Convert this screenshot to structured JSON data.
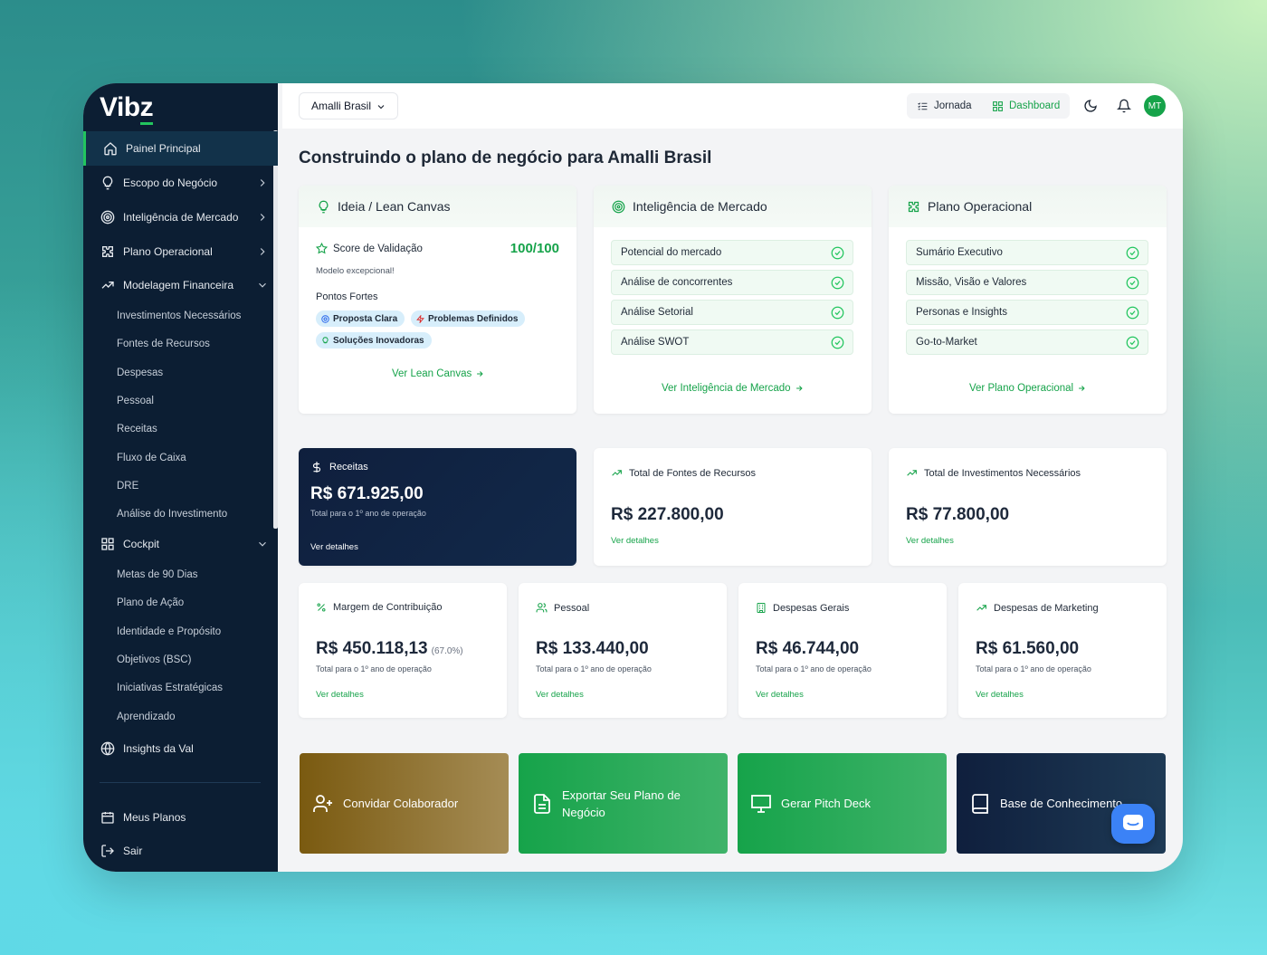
{
  "brand": {
    "logo_text": "Vib",
    "logo_z": "z"
  },
  "sidebar": {
    "items": [
      {
        "label": "Painel Principal"
      },
      {
        "label": "Escopo do Negócio"
      },
      {
        "label": "Inteligência de Mercado"
      },
      {
        "label": "Plano Operacional"
      },
      {
        "label": "Modelagem Financeira"
      },
      {
        "label": "Cockpit"
      },
      {
        "label": "Insights da Val"
      },
      {
        "label": "Meus Planos"
      },
      {
        "label": "Sair"
      }
    ],
    "financeira_sub": [
      "Investimentos Necessários",
      "Fontes de Recursos",
      "Despesas",
      "Pessoal",
      "Receitas",
      "Fluxo de Caixa",
      "DRE",
      "Análise do Investimento"
    ],
    "cockpit_sub": [
      "Metas de 90 Dias",
      "Plano de Ação",
      "Identidade e Propósito",
      "Objetivos (BSC)",
      "Iniciativas Estratégicas",
      "Aprendizado"
    ]
  },
  "header": {
    "company": "Amalli Brasil",
    "jornada": "Jornada",
    "dashboard": "Dashboard",
    "avatar": "MT"
  },
  "main": {
    "title": "Construindo o plano de negócio para Amalli Brasil",
    "lean": {
      "title": "Ideia / Lean Canvas",
      "score_label": "Score de Validação",
      "score_value": "100/100",
      "score_note": "Modelo excepcional!",
      "strengths_label": "Pontos Fortes",
      "pills": [
        "Proposta Clara",
        "Problemas Definidos",
        "Soluções Inovadoras"
      ],
      "link": "Ver Lean Canvas"
    },
    "mercado": {
      "title": "Inteligência de Mercado",
      "items": [
        "Potencial do mercado",
        "Análise de concorrentes",
        "Análise Setorial",
        "Análise SWOT"
      ],
      "link": "Ver Inteligência de Mercado"
    },
    "operacional": {
      "title": "Plano Operacional",
      "items": [
        "Sumário Executivo",
        "Missão, Visão e Valores",
        "Personas e Insights",
        "Go-to-Market"
      ],
      "link": "Ver Plano Operacional"
    },
    "receitas": {
      "label": "Receitas",
      "value": "R$ 671.925,00",
      "sub": "Total para o 1º ano de operação",
      "link": "Ver detalhes"
    },
    "fontes": {
      "label": "Total de Fontes de Recursos",
      "value": "R$ 227.800,00",
      "link": "Ver detalhes"
    },
    "investimentos": {
      "label": "Total de Investimentos Necessários",
      "value": "R$ 77.800,00",
      "link": "Ver detalhes"
    },
    "margem": {
      "label": "Margem de Contribuição",
      "value": "R$ 450.118,13",
      "pct": "(67.0%)",
      "sub": "Total para o 1º ano de operação",
      "link": "Ver detalhes"
    },
    "pessoal": {
      "label": "Pessoal",
      "value": "R$ 133.440,00",
      "sub": "Total para o 1º ano de operação",
      "link": "Ver detalhes"
    },
    "despesas_gerais": {
      "label": "Despesas Gerais",
      "value": "R$ 46.744,00",
      "sub": "Total para o 1º ano de operação",
      "link": "Ver detalhes"
    },
    "marketing": {
      "label": "Despesas de Marketing",
      "value": "R$ 61.560,00",
      "sub": "Total para o 1º ano de operação",
      "link": "Ver detalhes"
    },
    "actions": {
      "convidar": "Convidar Colaborador",
      "exportar": "Exportar Seu Plano de Negócio",
      "pitch": "Gerar Pitch Deck",
      "base": "Base de Conhecimento"
    }
  },
  "colors": {
    "accent": "#16a34a",
    "sidebar_bg": "#0c1e33",
    "dark_card": "#0f1f3d"
  }
}
